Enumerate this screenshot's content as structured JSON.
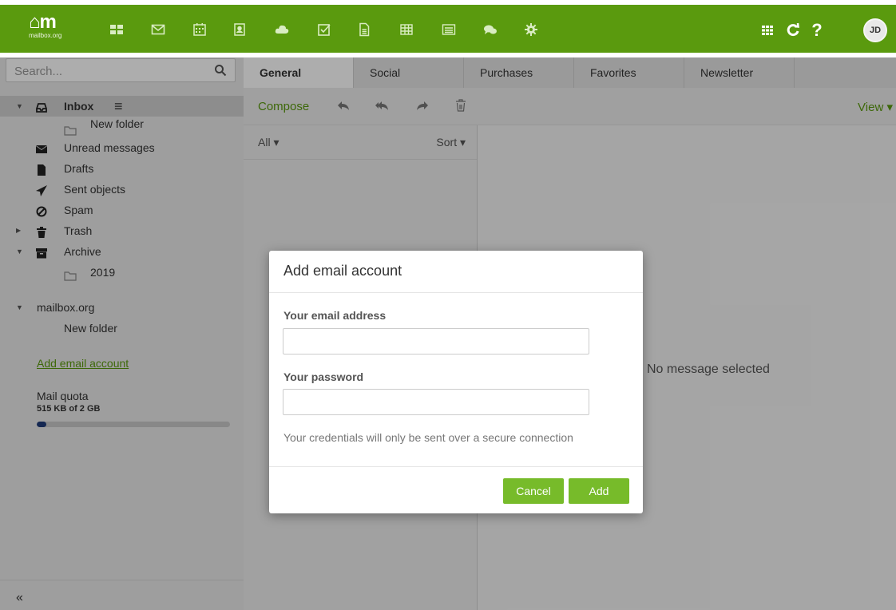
{
  "brand": {
    "logo_mark": "⌂m",
    "logo_sub": "mailbox.org",
    "color": "#5a9a0e"
  },
  "topbar": {
    "apps": [
      "portal-icon",
      "mail-icon",
      "calendar-icon",
      "address-book-icon",
      "drive-icon",
      "tasks-icon",
      "documents-icon",
      "spreadsheet-icon",
      "presentation-icon",
      "chat-icon",
      "settings-icon"
    ],
    "right": [
      "apps-grid-icon",
      "refresh-icon",
      "help-icon"
    ],
    "avatar_initials": "JD"
  },
  "sidebar": {
    "search_placeholder": "Search...",
    "folders": [
      {
        "label": "Inbox",
        "icon": "inbox-icon"
      },
      {
        "label": "New folder",
        "icon": "folder-icon"
      },
      {
        "label": "Unread messages",
        "icon": "envelope-icon"
      },
      {
        "label": "Drafts",
        "icon": "file-icon"
      },
      {
        "label": "Sent objects",
        "icon": "paper-plane-icon"
      },
      {
        "label": "Spam",
        "icon": "ban-icon"
      },
      {
        "label": "Trash",
        "icon": "trash-icon"
      },
      {
        "label": "Archive",
        "icon": "archive-icon"
      },
      {
        "label": "2019",
        "icon": "folder-icon"
      }
    ],
    "account": {
      "label": "mailbox.org",
      "subfolder": "New folder"
    },
    "add_account": "Add email account",
    "quota": {
      "label": "Mail quota",
      "value": "515 KB of 2 GB",
      "fraction": 0.05
    },
    "collapse": "«"
  },
  "tabs": [
    "General",
    "Social",
    "Purchases",
    "Favorites",
    "Newsletter"
  ],
  "toolbar": {
    "compose": "Compose",
    "view": "View ▾"
  },
  "list": {
    "filter": "All ▾",
    "sort": "Sort ▾"
  },
  "preview": {
    "empty": "No message selected"
  },
  "dialog": {
    "title": "Add email account",
    "email_label": "Your email address",
    "password_label": "Your password",
    "note": "Your credentials will only be sent over a secure connection",
    "cancel": "Cancel",
    "add": "Add"
  }
}
